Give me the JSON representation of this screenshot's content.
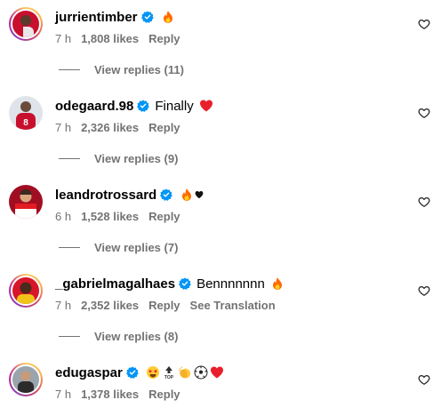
{
  "colors": {
    "secondary_text": "#737373",
    "verified_blue": "#0095f6"
  },
  "comments": [
    {
      "username": "jurrientimber",
      "text": "",
      "emojis": [
        "fire-emoji"
      ],
      "time": "7 h",
      "likes": "1,808 likes",
      "reply": "Reply",
      "translation": "",
      "view_replies": "View replies (11)",
      "avatar_ring": true
    },
    {
      "username": "odegaard.98",
      "text": "Finally",
      "emojis": [
        "red-heart-emoji"
      ],
      "time": "7 h",
      "likes": "2,326 likes",
      "reply": "Reply",
      "translation": "",
      "view_replies": "View replies (9)",
      "avatar_ring": false
    },
    {
      "username": "leandrotrossard",
      "text": "",
      "emojis": [
        "fire-emoji",
        "small-heart-emoji"
      ],
      "time": "6 h",
      "likes": "1,528 likes",
      "reply": "Reply",
      "translation": "",
      "view_replies": "View replies (7)",
      "avatar_ring": false
    },
    {
      "username": "_gabrielmagalhaes",
      "text": "Bennnnnnn",
      "emojis": [
        "fire-emoji"
      ],
      "time": "7 h",
      "likes": "2,352 likes",
      "reply": "Reply",
      "translation": "See Translation",
      "view_replies": "View replies (8)",
      "avatar_ring": true
    },
    {
      "username": "edugaspar",
      "text": "",
      "emojis": [
        "star-struck-emoji",
        "top-arrow-emoji",
        "clapping-hands-emoji",
        "soccer-ball-emoji",
        "red-heart-emoji"
      ],
      "time": "7 h",
      "likes": "1,378 likes",
      "reply": "Reply",
      "translation": "",
      "view_replies": "",
      "avatar_ring": true
    }
  ]
}
